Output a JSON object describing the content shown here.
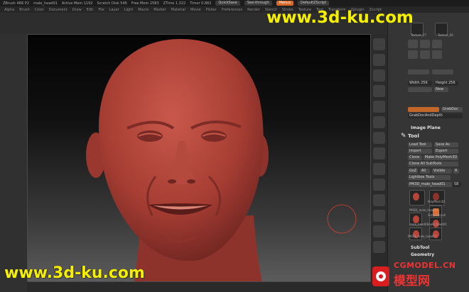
{
  "titlebar": {
    "app": "ZBrush 4R6 P2",
    "doc": "male_head01",
    "active_mem": "Active Mem 1192",
    "scratch_disk": "Scratch Disk 546",
    "free_mem": "Free Mem 2583",
    "ztime": "ZTime 1.322",
    "timer": "Timer 0.882",
    "quicksave": "QuickSave",
    "seethrough": "See-through",
    "menus_button": "Menus",
    "default_script": "DefaultZScript"
  },
  "menus": [
    "Alpha",
    "Brush",
    "Color",
    "Document",
    "Draw",
    "Edit",
    "File",
    "Layer",
    "Light",
    "Macro",
    "Marker",
    "Material",
    "Movie",
    "Picker",
    "Preferences",
    "Render",
    "Stencil",
    "Stroke",
    "Texture",
    "Tool",
    "Transform",
    "Zplugin",
    "Zscript"
  ],
  "panel": {
    "texture_left": "Texture_27",
    "texture_right": "Texture_66",
    "width_label": "Width 256",
    "height_label": "Height 256",
    "new_label": "New",
    "grabdoc": "GrabDoc",
    "grabdoc_depth": "GrabDocAndDepth",
    "image_plane": "Image Plane",
    "tool_header": "Tool",
    "load_tool": "Load Tool",
    "save_as": "Save As",
    "import": "Import",
    "export": "Export",
    "clone": "Clone",
    "make_polymesh": "Make PolyMesh3D",
    "clone_all": "Clone All SubTools",
    "goz": "GoZ",
    "all": "All",
    "visible": "Visible",
    "r": "R",
    "lightbox_tools": "Lightbox Tools",
    "current_tool": "PM3D_male_head01",
    "current_value": "58",
    "thumbs": [
      {
        "label": "PM3D_male_head01"
      },
      {
        "label": "PolyMesh3D"
      },
      {
        "label": "SimpleBrush"
      },
      {
        "label": "male_head01"
      },
      {
        "label": "male_head01"
      },
      {
        "label": "PM3D_male_head01"
      }
    ],
    "subtool": "SubTool",
    "geometry": "Geometry"
  },
  "watermarks": {
    "top": "www.3d-ku.com",
    "bottom": "www.3d-ku.com",
    "logo_site": "CGMODEL.CN",
    "logo_chars": "模型网"
  },
  "colors": {
    "skin": "#b94a3f",
    "accent": "#d8682a",
    "watermark": "#f6f000"
  }
}
